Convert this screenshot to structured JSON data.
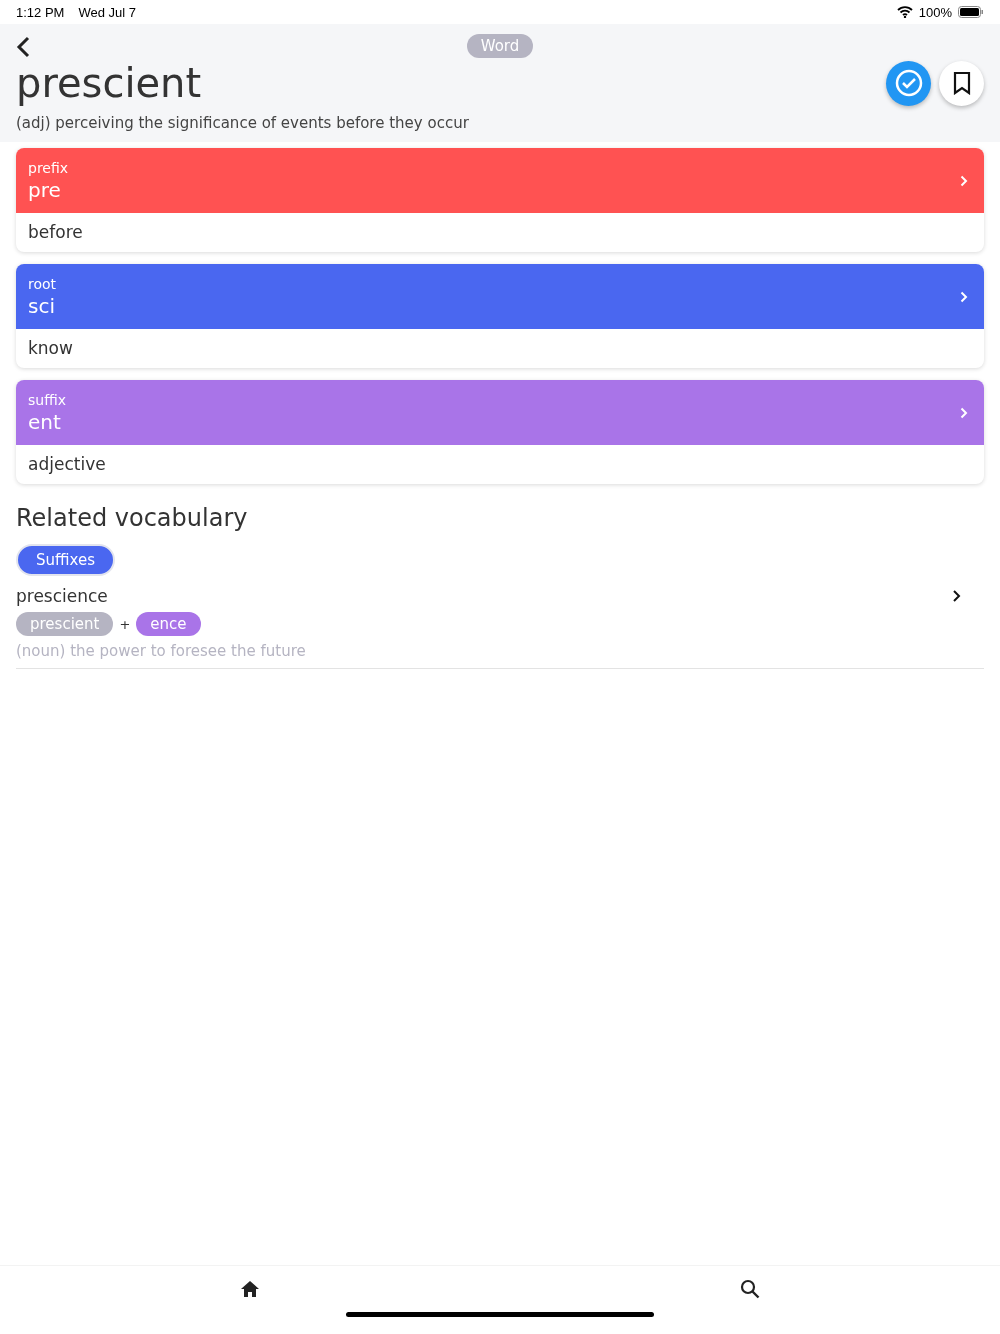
{
  "status_bar": {
    "time": "1:12 PM",
    "date": "Wed Jul 7",
    "battery": "100%"
  },
  "header": {
    "badge": "Word",
    "word": "prescient",
    "definition": "(adj) perceiving the significance of events before they occur",
    "learned": true
  },
  "parts": [
    {
      "type": "prefix",
      "text": "pre",
      "meaning": "before",
      "color": "#ff5252"
    },
    {
      "type": "root",
      "text": "sci",
      "meaning": "know",
      "color": "#4a67f0"
    },
    {
      "type": "suffix",
      "text": "ent",
      "meaning": "adjective",
      "color": "#a974e8"
    }
  ],
  "related": {
    "title": "Related vocabulary",
    "filters": [
      {
        "label": "Suffixes",
        "selected": true
      }
    ],
    "items": [
      {
        "word": "prescience",
        "parts": [
          {
            "text": "prescient",
            "color": "#b5b4c2"
          },
          {
            "text": "ence",
            "color": "#a974e8"
          }
        ],
        "joiner": "+",
        "definition": "(noun) the power to foresee the future"
      }
    ]
  }
}
